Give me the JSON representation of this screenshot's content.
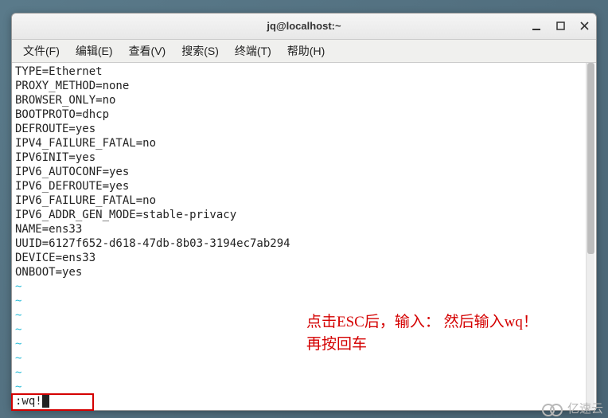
{
  "titlebar": {
    "title": "jq@localhost:~"
  },
  "menubar": {
    "items": [
      {
        "label": "文件(F)"
      },
      {
        "label": "编辑(E)"
      },
      {
        "label": "查看(V)"
      },
      {
        "label": "搜索(S)"
      },
      {
        "label": "终端(T)"
      },
      {
        "label": "帮助(H)"
      }
    ]
  },
  "terminal": {
    "lines": [
      "TYPE=Ethernet",
      "PROXY_METHOD=none",
      "BROWSER_ONLY=no",
      "BOOTPROTO=dhcp",
      "DEFROUTE=yes",
      "IPV4_FAILURE_FATAL=no",
      "IPV6INIT=yes",
      "IPV6_AUTOCONF=yes",
      "IPV6_DEFROUTE=yes",
      "IPV6_FAILURE_FATAL=no",
      "IPV6_ADDR_GEN_MODE=stable-privacy",
      "NAME=ens33",
      "UUID=6127f652-d618-47db-8b03-3194ec7ab294",
      "DEVICE=ens33",
      "ONBOOT=yes"
    ],
    "tilde": "~",
    "command": ":wq!"
  },
  "annotation": {
    "line1": "点击ESC后，输入：  然后输入wq！",
    "line2": "再按回车"
  },
  "watermark": {
    "text": "亿速云"
  }
}
